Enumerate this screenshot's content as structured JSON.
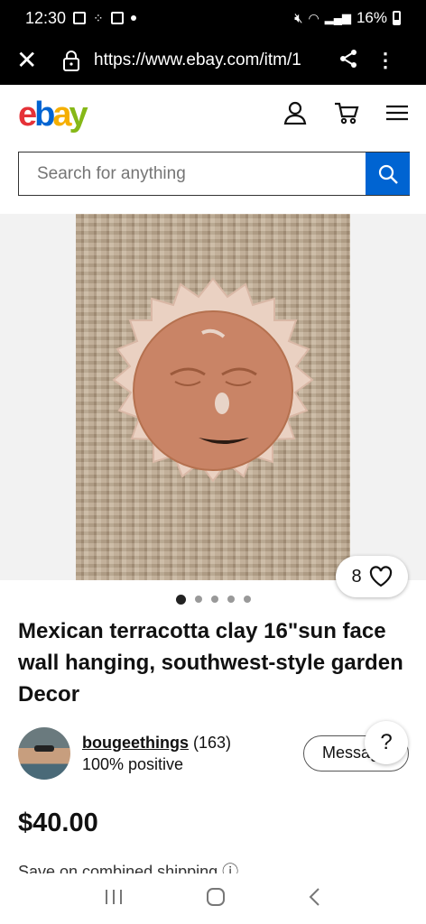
{
  "status": {
    "time": "12:30",
    "battery": "16%"
  },
  "browser": {
    "url": "https://www.ebay.com/itm/1"
  },
  "search": {
    "placeholder": "Search for anything"
  },
  "listing": {
    "favorites_count": "8",
    "title": "Mexican terracotta clay 16\"sun face wall hanging, southwest-style garden Decor",
    "image_index": 1,
    "image_total": 5,
    "price": "$40.00",
    "shipping_note": "Save on combined shipping"
  },
  "seller": {
    "name": "bougeethings",
    "feedback_count": "(163)",
    "positive": "100% positive",
    "message_label": "Message"
  },
  "help": {
    "label": "?"
  },
  "colors": {
    "brand_blue": "#0064d2",
    "ebay_red": "#e53238",
    "ebay_yellow": "#f5af02",
    "ebay_green": "#86b817"
  }
}
